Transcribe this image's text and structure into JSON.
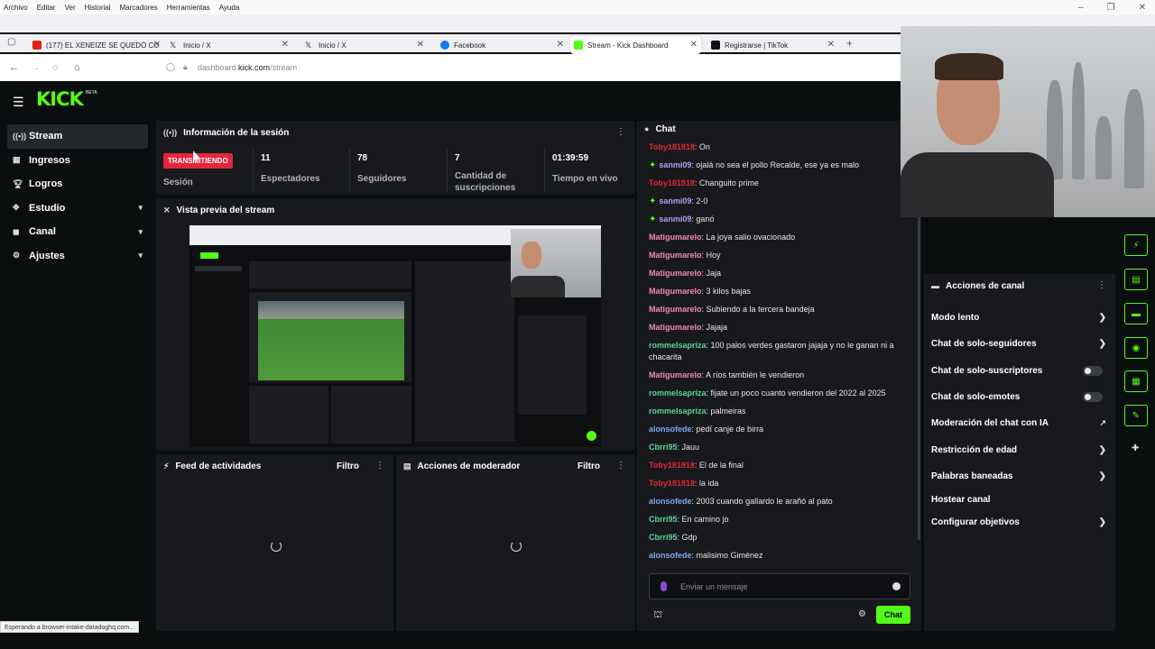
{
  "browser": {
    "menu": [
      "Archivo",
      "Editar",
      "Ver",
      "Historial",
      "Marcadores",
      "Herramientas",
      "Ayuda"
    ],
    "tabs": [
      {
        "label": "(177) EL XENEIZE SE QUEDÓ CO",
        "icon": "youtube-icon",
        "color": "#e62117"
      },
      {
        "label": "Inicio / X",
        "icon": "x-icon",
        "color": "#111111"
      },
      {
        "label": "Inicio / X",
        "icon": "x-icon",
        "color": "#111111"
      },
      {
        "label": "Facebook",
        "icon": "facebook-icon",
        "color": "#1877f2"
      },
      {
        "label": "Stream - Kick Dashboard",
        "icon": "kick-icon",
        "color": "#53fc18"
      },
      {
        "label": "Registrarse | TikTok",
        "icon": "tiktok-icon",
        "color": "#111111"
      }
    ],
    "url_host": "dashboard.",
    "url_domain": "kick.com",
    "url_path": "/stream",
    "status": "Esperando a browser-intake-datadoghq.com..."
  },
  "app": {
    "logo": "KICK",
    "logo_badge": "BETA",
    "sidebar": [
      {
        "label": "Stream",
        "icon": "stream-icon",
        "active": true
      },
      {
        "label": "Ingresos",
        "icon": "revenue-icon"
      },
      {
        "label": "Logros",
        "icon": "trophy-icon"
      },
      {
        "label": "Estudio",
        "icon": "studio-icon",
        "expandable": true
      },
      {
        "label": "Canal",
        "icon": "channel-icon",
        "expandable": true
      },
      {
        "label": "Ajustes",
        "icon": "settings-icon",
        "expandable": true
      }
    ]
  },
  "session": {
    "title": "Información de la sesión",
    "status_badge": "TRANSMITIENDO",
    "status_label": "Sesión",
    "viewers": "11",
    "viewers_label": "Espectadores",
    "followers": "78",
    "followers_label": "Seguidores",
    "subs": "7",
    "subs_label": "Cantidad de suscripciones",
    "time": "01:39:59",
    "time_label": "Tiempo en vivo"
  },
  "preview": {
    "title": "Vista previa del stream"
  },
  "feed": {
    "title": "Feed de actividades",
    "filter": "Filtro"
  },
  "mod_actions": {
    "title": "Acciones de moderador",
    "filter": "Filtro"
  },
  "chat": {
    "title": "Chat",
    "placeholder": "Enviar un mensaje",
    "send": "Chat",
    "messages": [
      {
        "user": "Toby181818",
        "text": ": On",
        "color": "#e3263c",
        "badge": false
      },
      {
        "user": "sanmi09",
        "text": ": ojalá no sea el pollo Recalde, ese ya es malo",
        "color": "#b79cf2",
        "badge": true
      },
      {
        "user": "Toby181818",
        "text": ": Changuito prime",
        "color": "#e3263c",
        "badge": false
      },
      {
        "user": "sanmi09",
        "text": ": 2-0",
        "color": "#b79cf2",
        "badge": true
      },
      {
        "user": "sanmi09",
        "text": ": ganó",
        "color": "#b79cf2",
        "badge": true
      },
      {
        "user": "Matigumarelo",
        "text": ": La joya salio ovacionado",
        "color": "#f28ab9",
        "badge": false
      },
      {
        "user": "Matigumarelo",
        "text": ": Hoy",
        "color": "#f28ab9",
        "badge": false
      },
      {
        "user": "Matigumarelo",
        "text": ": Jaja",
        "color": "#f28ab9",
        "badge": false
      },
      {
        "user": "Matigumarelo",
        "text": ": 3 kilos bajas",
        "color": "#f28ab9",
        "badge": false
      },
      {
        "user": "Matigumarelo",
        "text": ": Subiendo a la tercera bandeja",
        "color": "#f28ab9",
        "badge": false
      },
      {
        "user": "Matigumarelo",
        "text": ": Jajaja",
        "color": "#f28ab9",
        "badge": false
      },
      {
        "user": "rommelsapriza",
        "text": ": 100 palos verdes gastaron jajaja y no le ganan ni a chacarita",
        "color": "#5fd39a",
        "badge": false
      },
      {
        "user": "Matigumarelo",
        "text": ": A ríos también le vendieron",
        "color": "#f28ab9",
        "badge": false
      },
      {
        "user": "rommelsapriza",
        "text": ": fijate un poco cuanto vendieron del 2022 al 2025",
        "color": "#5fd39a",
        "badge": false
      },
      {
        "user": "rommelsapriza",
        "text": ": palmeiras",
        "color": "#5fd39a",
        "badge": false
      },
      {
        "user": "alonsofede",
        "text": ": pedí canje de birra",
        "color": "#7fa8f0",
        "badge": false
      },
      {
        "user": "Cbrri95",
        "text": ": Jauu",
        "color": "#5fd39a",
        "badge": false
      },
      {
        "user": "Toby181818",
        "text": ": El de la final",
        "color": "#e3263c",
        "badge": false
      },
      {
        "user": "Toby181818",
        "text": ": la ida",
        "color": "#e3263c",
        "badge": false
      },
      {
        "user": "alonsofede",
        "text": ": 2003 cuando gallardo le arañó al pato",
        "color": "#7fa8f0",
        "badge": false
      },
      {
        "user": "Cbrri95",
        "text": ": En camino jo",
        "color": "#5fd39a",
        "badge": false
      },
      {
        "user": "Cbrri95",
        "text": ": Gdp",
        "color": "#5fd39a",
        "badge": false
      },
      {
        "user": "alonsofede",
        "text": ": malisimo Giménez",
        "color": "#7fa8f0",
        "badge": false
      }
    ]
  },
  "channel_actions": {
    "title": "Acciones de canal",
    "items": [
      {
        "label": "Modo lento",
        "control": "chevron"
      },
      {
        "label": "Chat de solo-seguidores",
        "control": "chevron"
      },
      {
        "label": "Chat de solo-suscriptores",
        "control": "toggle"
      },
      {
        "label": "Chat de solo-emotes",
        "control": "toggle"
      },
      {
        "label": "Moderación del chat con IA",
        "control": "external"
      },
      {
        "label": "Restricción de edad",
        "control": "chevron"
      },
      {
        "label": "Palabras baneadas",
        "control": "chevron"
      },
      {
        "label": "Hostear canal",
        "control": "none"
      },
      {
        "label": "Configurar objetivos",
        "control": "chevron"
      }
    ]
  },
  "colors": {
    "accent": "#53fc18",
    "live": "#e3263c",
    "panel": "#17191c",
    "bg": "#0b0e0f"
  }
}
